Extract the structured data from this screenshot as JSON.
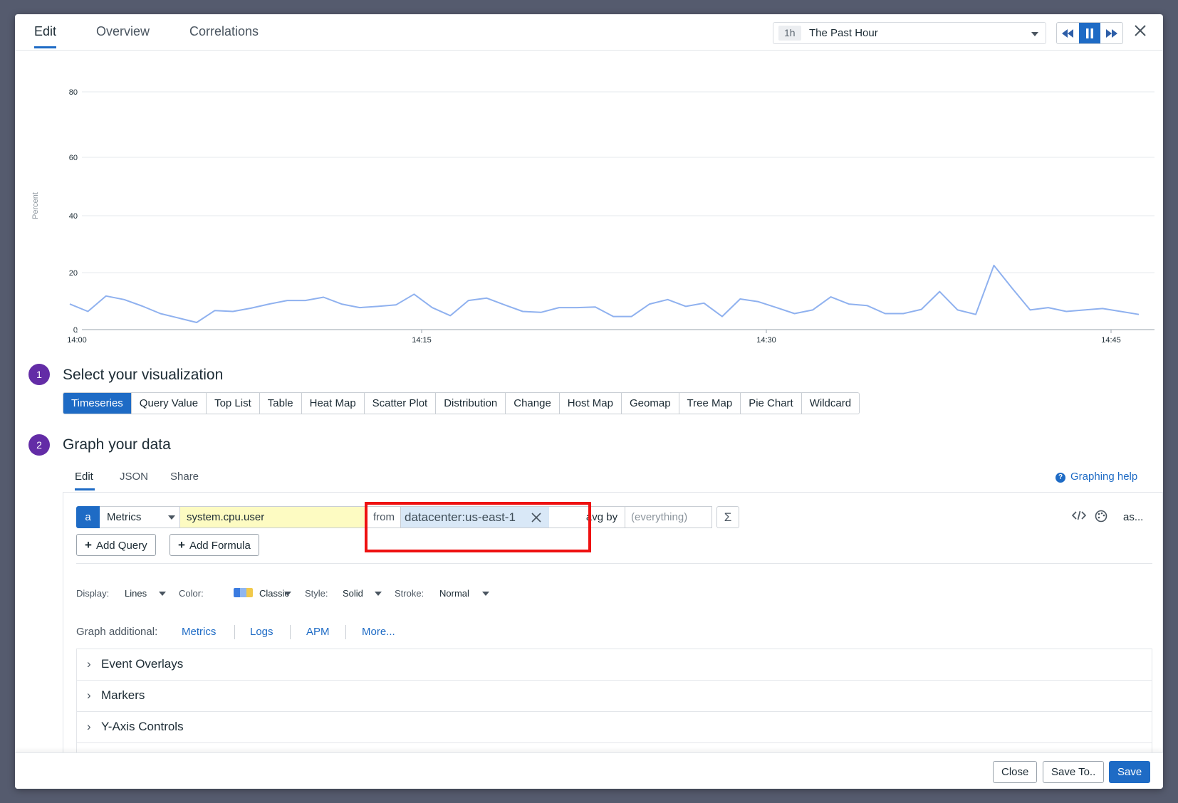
{
  "tabs": {
    "edit": "Edit",
    "overview": "Overview",
    "correlations": "Correlations"
  },
  "time": {
    "badge": "1h",
    "label": "The Past Hour"
  },
  "playback": {
    "rewind_icon": "rewind-icon",
    "pause_icon": "pause-icon",
    "forward_icon": "fast-forward-icon"
  },
  "close_icon": "close-icon",
  "chart_data": {
    "type": "line",
    "ylabel": "Percent",
    "ylim": [
      0,
      80
    ],
    "yticks": [
      "80",
      "60",
      "40",
      "20",
      "0"
    ],
    "xticks": [
      "14:00",
      "14:15",
      "14:30",
      "14:45"
    ],
    "grid": true,
    "color": "#8fb1ef",
    "series": [
      {
        "values": [
          8.6,
          6.1,
          11.3,
          10.1,
          7.9,
          5.4,
          3.9,
          2.4,
          6.4,
          6.1,
          7.2,
          8.6,
          9.8,
          9.8,
          10.9,
          8.6,
          7.4,
          7.8,
          8.3,
          11.9,
          7.4,
          4.7,
          9.8,
          10.6,
          8.3,
          6.1,
          5.8,
          7.4,
          7.4,
          7.6,
          4.4,
          4.4,
          8.6,
          10.1,
          7.8,
          8.9,
          4.4,
          10.3,
          9.4,
          7.4,
          5.4,
          6.6,
          11.0,
          8.6,
          8.1,
          5.4,
          5.4,
          6.8,
          12.8,
          6.6,
          5.1,
          21.6,
          14.0,
          6.6,
          7.4,
          6.1,
          6.6,
          7.1,
          6.1,
          5.1
        ]
      }
    ]
  },
  "step1": {
    "num": "1",
    "title": "Select your visualization"
  },
  "viz_types": [
    "Timeseries",
    "Query Value",
    "Top List",
    "Table",
    "Heat Map",
    "Scatter Plot",
    "Distribution",
    "Change",
    "Host Map",
    "Geomap",
    "Tree Map",
    "Pie Chart",
    "Wildcard"
  ],
  "step2": {
    "num": "2",
    "title": "Graph your data"
  },
  "subtabs": {
    "edit": "Edit",
    "json": "JSON",
    "share": "Share"
  },
  "graphing_help": "Graphing help",
  "query": {
    "letter": "a",
    "source": "Metrics",
    "metric": "system.cpu.user",
    "from_label": "from",
    "tag": "datacenter:us-east-1",
    "avg_by": "avg by",
    "group_placeholder": "(everything)",
    "sigma": "Σ",
    "as_label": "as..."
  },
  "buttons": {
    "add_query": "Add Query",
    "add_formula": "Add Formula"
  },
  "options": {
    "display_label": "Display:",
    "display_value": "Lines",
    "color_label": "Color:",
    "color_value": "Classic",
    "style_label": "Style:",
    "style_value": "Solid",
    "stroke_label": "Stroke:",
    "stroke_value": "Normal",
    "swatch_colors": [
      "#3a7be0",
      "#8fb6f0",
      "#f1c94b"
    ]
  },
  "graph_additional": {
    "label": "Graph additional:",
    "links": [
      "Metrics",
      "Logs",
      "APM",
      "More..."
    ]
  },
  "accordions": [
    "Event Overlays",
    "Markers",
    "Y-Axis Controls"
  ],
  "footer": {
    "close": "Close",
    "save_to": "Save To..",
    "save": "Save"
  }
}
